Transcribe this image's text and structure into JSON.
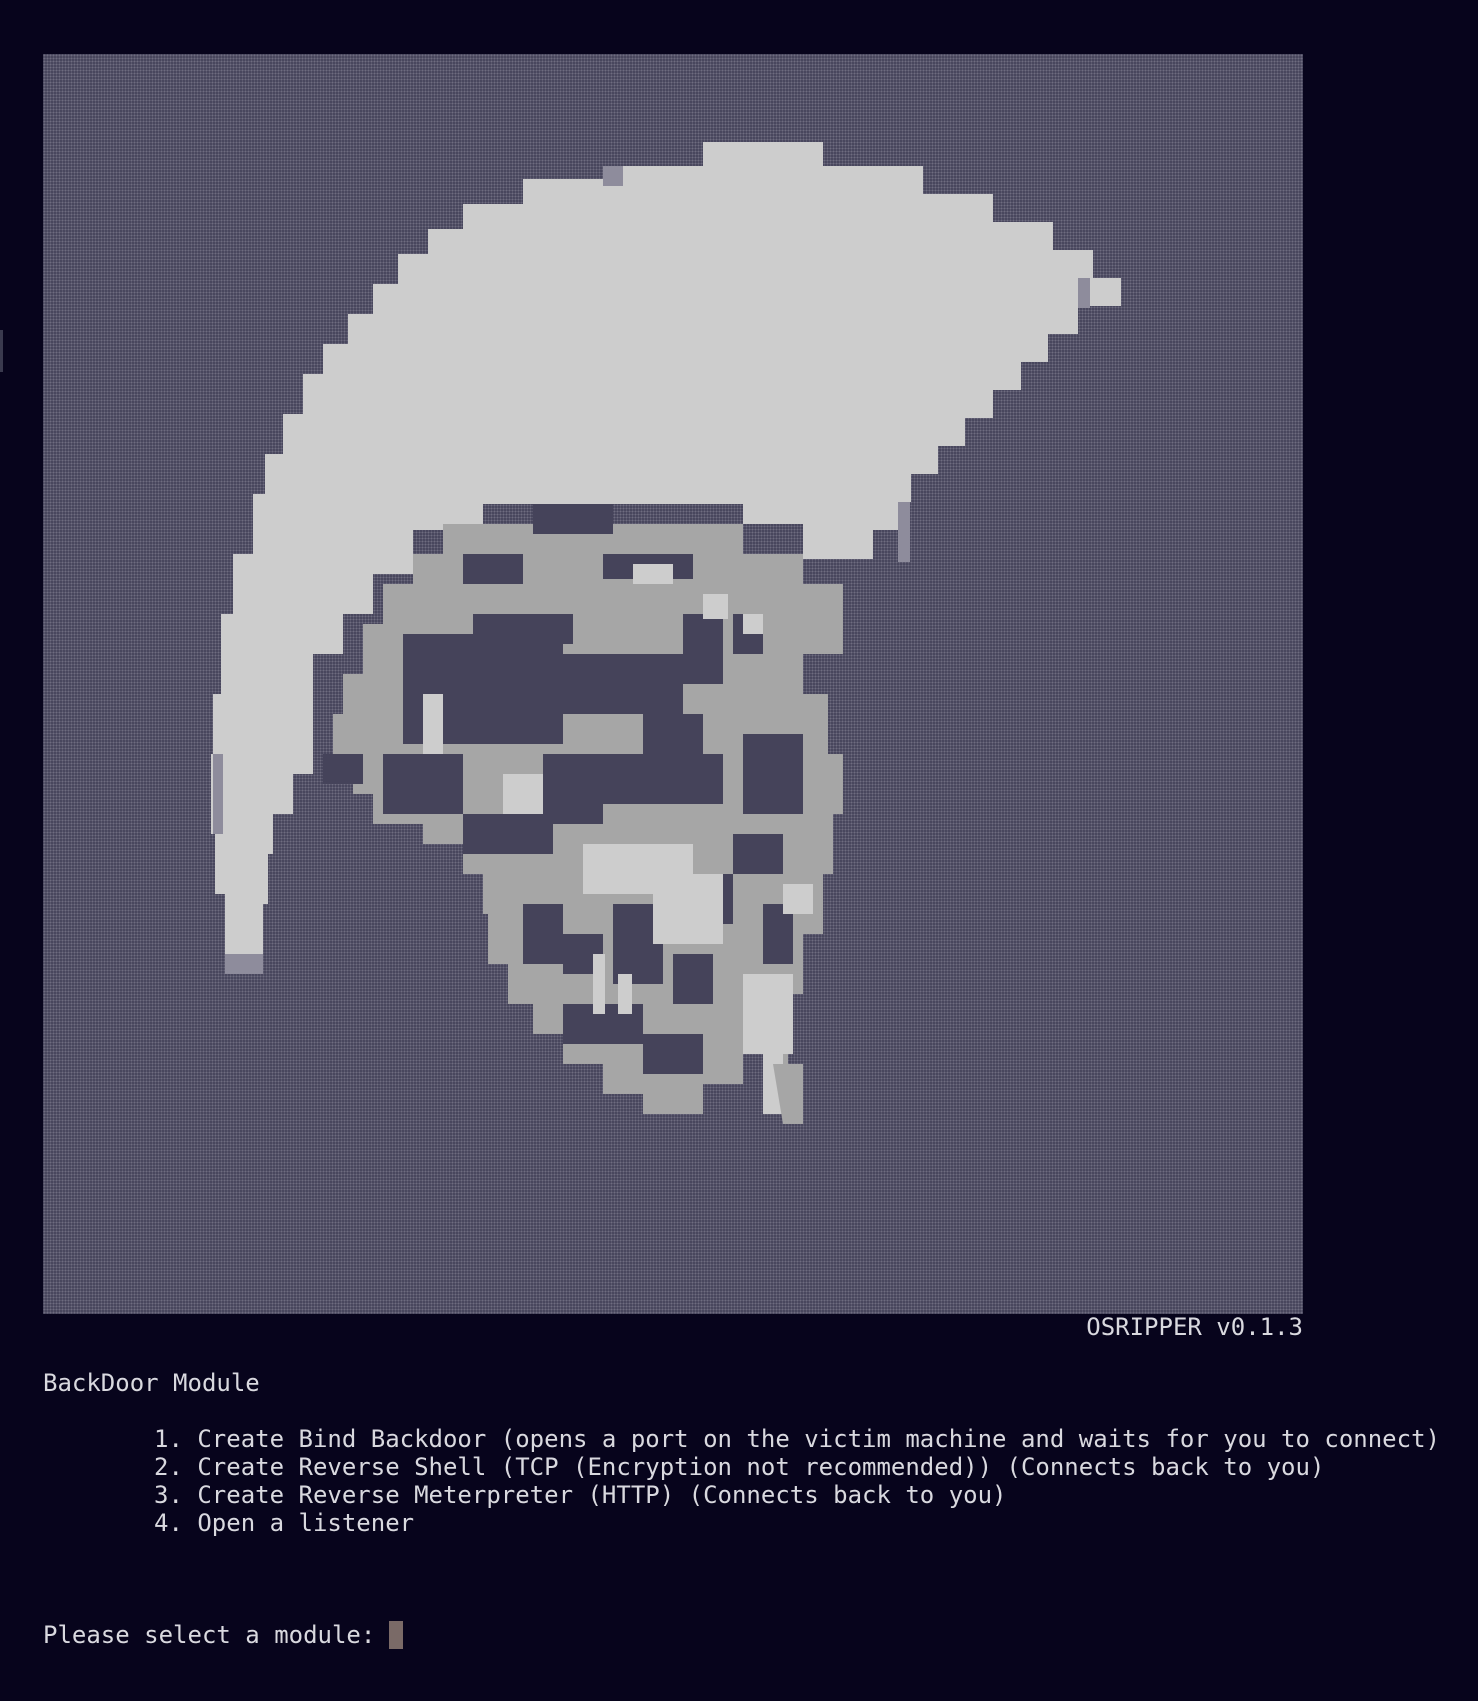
{
  "app": {
    "version_label": "OSRIPPER v0.1.3",
    "art_name": "pixel-ninja-head-art"
  },
  "module": {
    "title": "BackDoor Module"
  },
  "menu": {
    "items": [
      {
        "label": "1. Create Bind Backdoor (opens a port on the victim machine and waits for you to connect)"
      },
      {
        "label": "2. Create Reverse Shell (TCP (Encryption not recommended)) (Connects back to you)"
      },
      {
        "label": "3. Create Reverse Meterpreter (HTTP) (Connects back to you)"
      },
      {
        "label": "4. Open a listener"
      }
    ]
  },
  "prompt": {
    "text": "Please select a module:"
  },
  "colors": {
    "background": "#07041c",
    "text": "#d9d9df",
    "art_light": "#cdcdcd",
    "art_mid": "#a6a6a6",
    "art_dark": "#45435a",
    "cursor": "#7a6a67"
  }
}
